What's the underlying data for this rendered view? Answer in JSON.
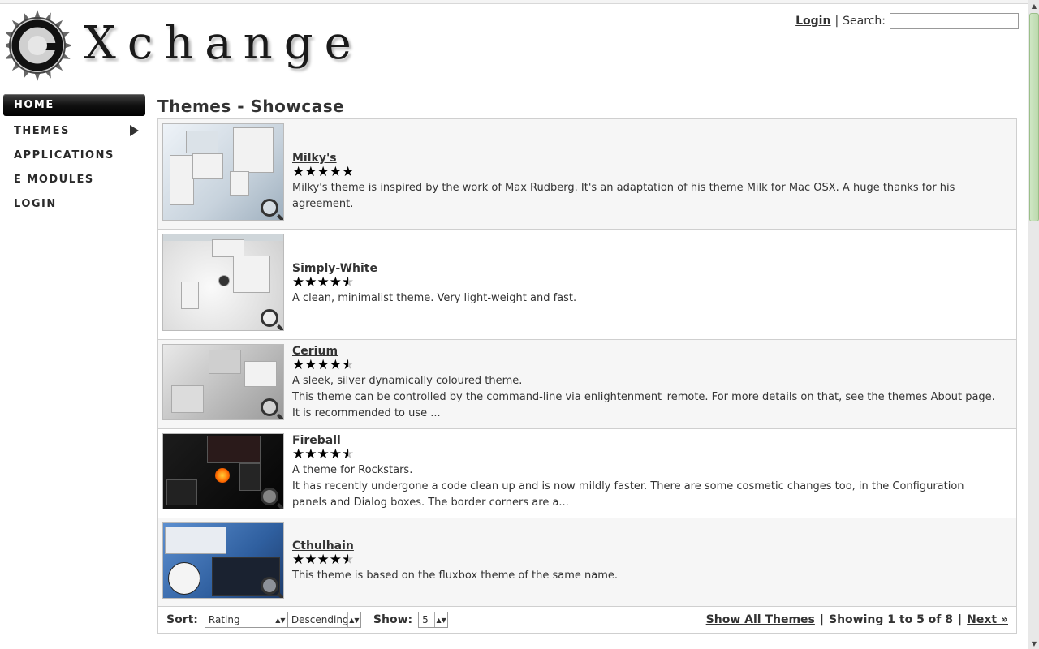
{
  "header": {
    "logo_text": "Xchange",
    "login_label": "Login",
    "separator": "|",
    "search_label": "Search:",
    "search_value": ""
  },
  "sidebar": {
    "items": [
      {
        "label": "HOME"
      },
      {
        "label": "THEMES"
      },
      {
        "label": "APPLICATIONS"
      },
      {
        "label": "E MODULES"
      },
      {
        "label": "LOGIN"
      }
    ]
  },
  "main": {
    "title": "Themes - Showcase",
    "themes": [
      {
        "title": "Milky's",
        "rating": 5,
        "desc": [
          "Milky's theme is inspired by the work of Max Rudberg. It's an adaptation of his theme Milk for Mac OSX. A huge thanks for his agreement."
        ]
      },
      {
        "title": "Simply-White",
        "rating": 4.5,
        "desc": [
          "A clean, minimalist theme. Very light-weight and fast."
        ]
      },
      {
        "title": "Cerium",
        "rating": 4.5,
        "desc": [
          "A sleek, silver dynamically coloured theme.",
          "This theme can be controlled by the command-line via enlightenment_remote. For more details on that, see the themes About page.",
          "It is recommended to use ..."
        ]
      },
      {
        "title": "Fireball",
        "rating": 4.5,
        "desc": [
          "A theme for Rockstars.",
          "It has recently undergone a code clean up and is now mildly faster. There are some cosmetic changes too, in the Configuration panels and Dialog boxes. The border corners are a..."
        ]
      },
      {
        "title": "Cthulhain",
        "rating": 4.5,
        "desc": [
          "This theme is based on the fluxbox theme of the same name."
        ]
      }
    ]
  },
  "footer": {
    "sort_label": "Sort:",
    "sort_value": "Rating",
    "order_value": "Descending",
    "show_label": "Show:",
    "show_value": "5",
    "show_all": "Show All Themes",
    "showing": "Showing 1 to 5 of 8",
    "next": "Next »",
    "separator": "|"
  },
  "colors": {
    "nav_active_bg": "#000000",
    "row_alt": "#f6f6f6",
    "scroll_thumb": "#c6e0b8"
  }
}
